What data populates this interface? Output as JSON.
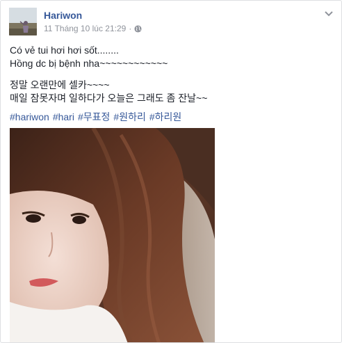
{
  "post": {
    "author": "Hariwon",
    "timestamp": "11 Tháng 10 lúc 21:29",
    "separator": "·",
    "privacy_icon": "globe-icon",
    "menu_icon": "chevron-down-icon",
    "text_lines": [
      "Có vẻ tui hơi hơi sốt........",
      "Hồng dc bị bệnh nha~~~~~~~~~~~~",
      "정말 오랜만에 셀카~~~~",
      "매일 잠못자며 일하다가 오늘은 그래도 좀 잔날~~"
    ],
    "hashtags": [
      "#hariwon",
      "#hari",
      "#무표정",
      "#원하리",
      "#하리원"
    ]
  },
  "colors": {
    "link": "#365899",
    "text": "#1d2129",
    "meta": "#90949c"
  }
}
